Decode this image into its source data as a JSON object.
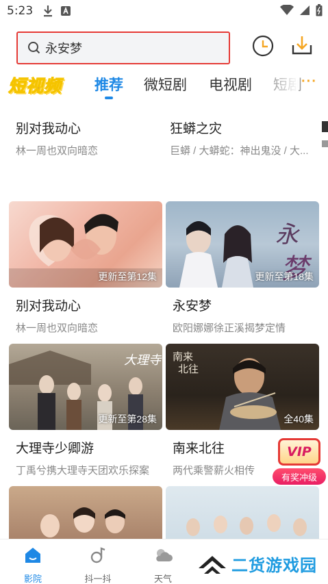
{
  "status_bar": {
    "time": "5:23"
  },
  "search": {
    "query": "永安梦"
  },
  "tabs": {
    "brand": "短视频",
    "items": [
      {
        "label": "推荐",
        "active": true
      },
      {
        "label": "微短剧",
        "active": false
      },
      {
        "label": "电视剧",
        "active": false
      },
      {
        "label": "短剧",
        "active": false
      }
    ],
    "more": "···"
  },
  "top_row": [
    {
      "title": "别对我动心",
      "subtitle": "林一周也双向暗恋"
    },
    {
      "title": "狂蟒之灾",
      "subtitle": "巨蟒 / 大蟒蛇：神出鬼没 / 大..."
    }
  ],
  "cards": [
    {
      "title": "别对我动心",
      "subtitle": "林一周也双向暗恋",
      "badge": "更新至第12集"
    },
    {
      "title": "永安梦",
      "subtitle": "欧阳娜娜徐正溪揭梦定情",
      "badge": "更新至第18集"
    },
    {
      "title": "大理寺少卿游",
      "subtitle": "丁禹兮携大理寺天团欢乐探案",
      "badge": "更新至第28集"
    },
    {
      "title": "南来北往",
      "subtitle": "两代乘警薪火相传",
      "badge": "全40集"
    }
  ],
  "vip": {
    "badge": "VIP",
    "button": "有奖冲级"
  },
  "bottom_nav": [
    {
      "label": "影院",
      "active": true
    },
    {
      "label": "抖一抖",
      "active": false
    },
    {
      "label": "天气",
      "active": false
    }
  ],
  "watermark": {
    "text": "二货游戏园"
  },
  "colors": {
    "accent": "#1e88e5",
    "search_border": "#e53935",
    "history_icon": "#f5a623"
  }
}
